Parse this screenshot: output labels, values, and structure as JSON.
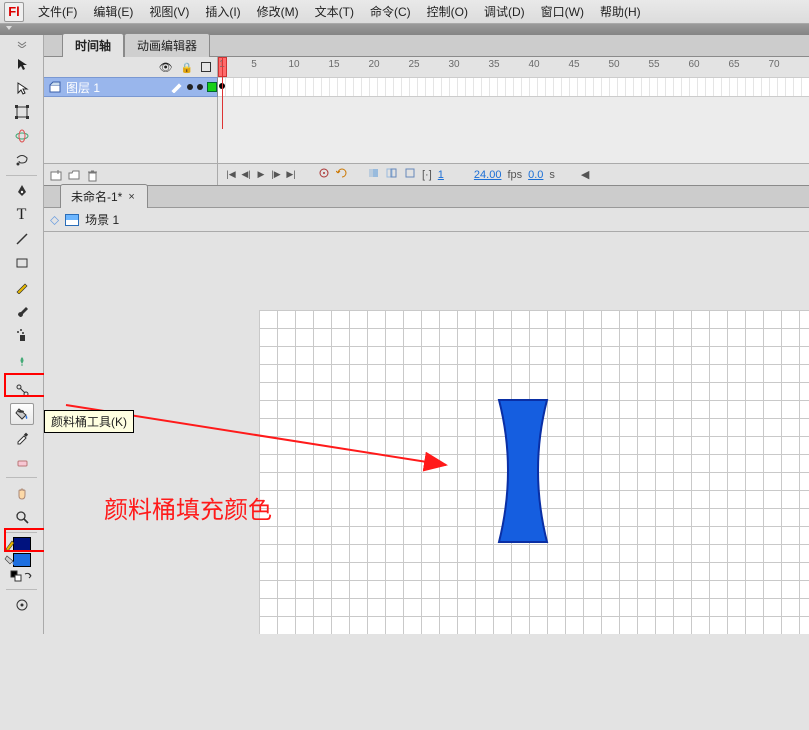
{
  "menu": {
    "items": [
      "文件(F)",
      "编辑(E)",
      "视图(V)",
      "插入(I)",
      "修改(M)",
      "文本(T)",
      "命令(C)",
      "控制(O)",
      "调试(D)",
      "窗口(W)",
      "帮助(H)"
    ]
  },
  "panels": {
    "timeline_tab": "时间轴",
    "anim_editor_tab": "动画编辑器"
  },
  "timeline": {
    "layer_name": "图层 1",
    "ruler": [
      1,
      5,
      10,
      15,
      20,
      25,
      30,
      35,
      40,
      45,
      50,
      55,
      60,
      65,
      70
    ],
    "current_frame": "1",
    "fps": "24.00",
    "fps_label": "fps",
    "elapsed": "0.0",
    "elapsed_label": "s"
  },
  "document": {
    "tab_title": "未命名-1*",
    "scene_label": "场景 1"
  },
  "tooltip": {
    "paint_bucket": "颜料桶工具(K)"
  },
  "annotation": {
    "text": "颜料桶填充颜色"
  },
  "colors": {
    "stroke_swatch": "#00127e",
    "fill_swatch": "#1d6fe0",
    "shape_fill": "#155ee0",
    "shape_stroke": "#0a2fa5"
  },
  "logo": "Fl"
}
